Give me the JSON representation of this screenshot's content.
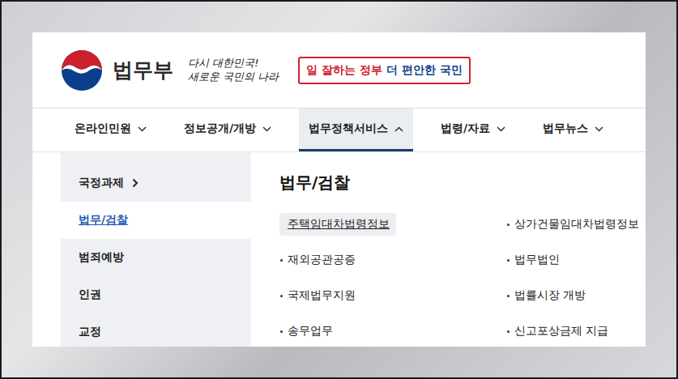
{
  "header": {
    "logo": "법무부",
    "motto": [
      "다시 대한민국!",
      "새로운 국민의 나라"
    ],
    "slogan": {
      "red": "일 잘하는 정부",
      "blue": "더 편안한 국민"
    }
  },
  "nav": [
    {
      "label": "온라인민원",
      "selected": false,
      "expanded": false
    },
    {
      "label": "정보공개/개방",
      "selected": false,
      "expanded": false
    },
    {
      "label": "법무정책서비스",
      "selected": true,
      "expanded": true
    },
    {
      "label": "법령/자료",
      "selected": false,
      "expanded": false
    },
    {
      "label": "법무뉴스",
      "selected": false,
      "expanded": false
    }
  ],
  "sidebar": [
    {
      "label": "국정과제",
      "selected": false,
      "expandable": true
    },
    {
      "label": "법무/검찰",
      "selected": true,
      "expandable": false
    },
    {
      "label": "범죄예방",
      "selected": false,
      "expandable": false
    },
    {
      "label": "인권",
      "selected": false,
      "expandable": false
    },
    {
      "label": "교정",
      "selected": false,
      "expandable": false
    }
  ],
  "panel": {
    "title": "법무/검찰",
    "links": [
      {
        "label": "주택임대차법령정보",
        "selected": true
      },
      {
        "label": "상가건물임대차법령정보",
        "selected": false
      },
      {
        "label": "재외공관공증",
        "selected": false
      },
      {
        "label": "법무법인",
        "selected": false
      },
      {
        "label": "국제법무지원",
        "selected": false
      },
      {
        "label": "법률시장 개방",
        "selected": false
      },
      {
        "label": "송무업무",
        "selected": false
      },
      {
        "label": "신고포상금제 지급",
        "selected": false
      }
    ]
  }
}
